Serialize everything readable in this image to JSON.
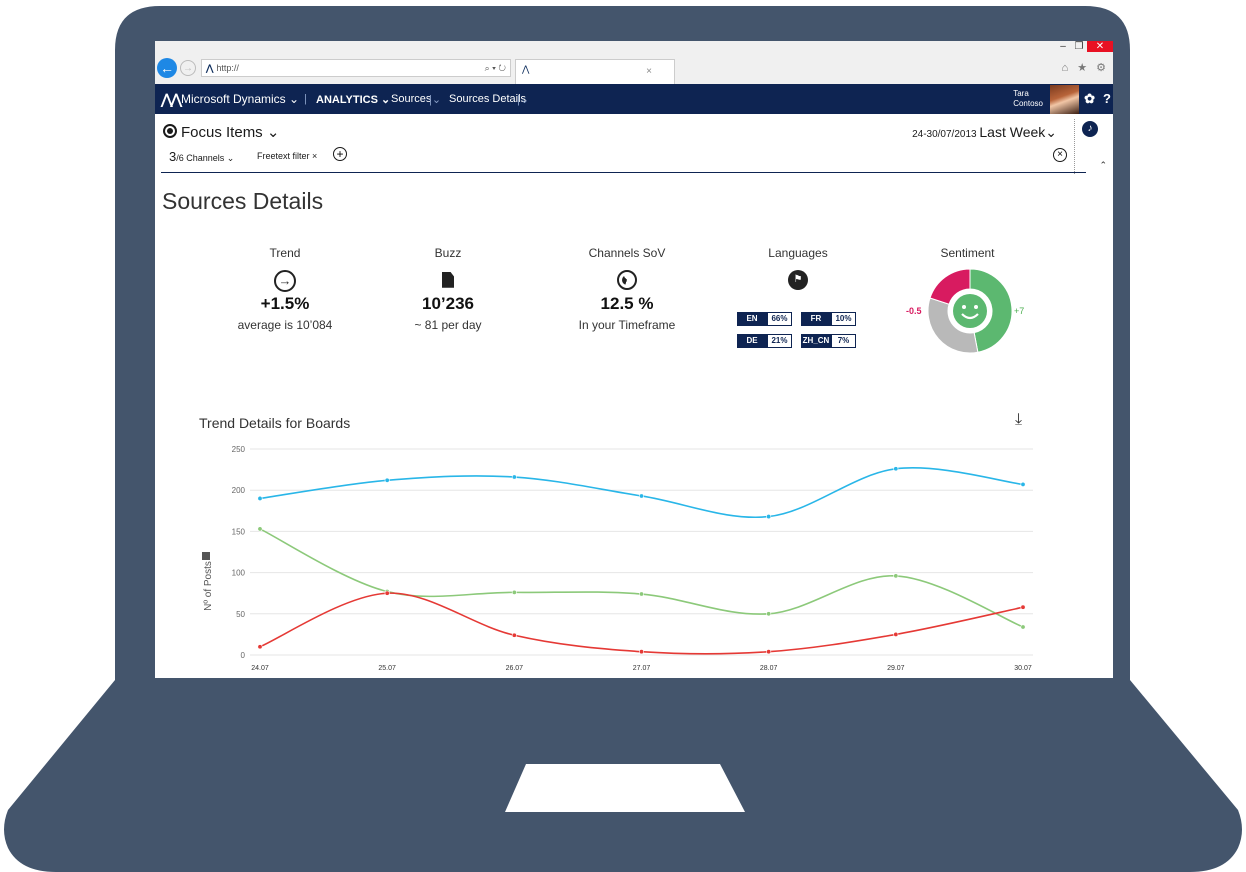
{
  "browser": {
    "address": "http://",
    "address_controls": "⌕ ▾ ↻",
    "window_controls": [
      "–",
      "❐",
      "✕"
    ],
    "toolbar_icons": "⌂ ★ ⚙"
  },
  "navbar": {
    "brand": "Microsoft Dynamics ⌄",
    "analytics": "ANALYTICS ⌄",
    "sources": "Sources",
    "sources_details": "Sources Details",
    "user_name": "Tara",
    "user_org": "Contoso",
    "icons": [
      "gear-icon",
      "help-icon"
    ]
  },
  "focus": {
    "title": "Focus Items ⌄",
    "channels_count": "3",
    "channels_label": "/6 Channels ⌄",
    "freetext_filter": "Freetext filter ×",
    "date_range": "24-30/07/2013",
    "period": "Last Week⌄"
  },
  "page": {
    "title": "Sources Details"
  },
  "kpis": [
    {
      "label": "Trend",
      "value": "+1.5%",
      "sub": "average is 10’084"
    },
    {
      "label": "Buzz",
      "value": "10’236",
      "sub": "~ 81 per day"
    },
    {
      "label": "Channels SoV",
      "value": "12.5 %",
      "sub": "In your Timeframe"
    },
    {
      "label": "Languages"
    },
    {
      "label": "Sentiment",
      "neg": "-0.5",
      "pos": "+7"
    }
  ],
  "languages": [
    {
      "code": "EN",
      "pct": "66%"
    },
    {
      "code": "FR",
      "pct": "10%"
    },
    {
      "code": "DE",
      "pct": "21%"
    },
    {
      "code": "ZH_CN",
      "pct": "7%"
    }
  ],
  "sentiment_segments": [
    {
      "name": "positive",
      "value": 47,
      "color": "#5cb870"
    },
    {
      "name": "neutral",
      "value": 33,
      "color": "#b9b9b9"
    },
    {
      "name": "negative",
      "value": 20,
      "color": "#d81b60"
    }
  ],
  "chart_data": {
    "type": "line",
    "title": "Trend Details for Boards",
    "ylabel": "Nº of Posts",
    "xlabel": "",
    "ylim": [
      0,
      250
    ],
    "yticks": [
      0,
      50,
      100,
      150,
      200,
      250
    ],
    "categories": [
      "24.07",
      "25.07",
      "26.07",
      "27.07",
      "28.07",
      "29.07",
      "30.07"
    ],
    "series": [
      {
        "color": "#29b6e8",
        "values": [
          190,
          212,
          216,
          193,
          168,
          226,
          207
        ]
      },
      {
        "color": "#8cc97a",
        "values": [
          153,
          77,
          76,
          74,
          50,
          96,
          34
        ]
      },
      {
        "color": "#e53935",
        "values": [
          10,
          75,
          24,
          4,
          4,
          25,
          58
        ]
      }
    ]
  }
}
